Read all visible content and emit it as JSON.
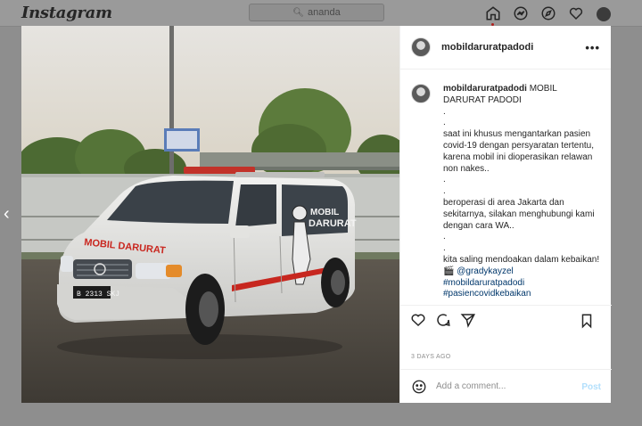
{
  "nav": {
    "logo": "Instagram",
    "search_value": "ananda",
    "icons": [
      "home-icon",
      "messenger-icon",
      "explore-icon",
      "heart-icon",
      "profile-avatar"
    ]
  },
  "post": {
    "username": "mobildaruratpadodi",
    "more": "•••",
    "caption": {
      "username": "mobildaruratpadodi",
      "lines": [
        "MOBIL DARURAT PADODI",
        ".",
        ".",
        "saat ini khusus mengantarkan pasien covid-19 dengan persyaratan tertentu, karena mobil ini dioperasikan relawan non nakes..",
        ".",
        ".",
        "beroperasi di area Jakarta dan sekitarnya, silakan menghubungi kami dengan cara WA..",
        ".",
        ".",
        "kita saling mendoakan dalam kebaikan!",
        "@gradykayzel",
        "#mobildaruratpadodi",
        "#pasiencovidkebaikan"
      ],
      "camera_emoji": "🎬"
    },
    "photo": {
      "van_plate": "B 2313 SKJ",
      "van_hood_text": "MOBIL DARURAT",
      "van_side_text": "MOBIL DARURAT"
    },
    "timestamp": "3 DAYS AGO",
    "comment_placeholder": "Add a comment...",
    "post_label": "Post"
  },
  "colors": {
    "accent_link": "#00376b",
    "post_button": "#b2dffc",
    "overlay_bg": "#8e8e8e"
  }
}
